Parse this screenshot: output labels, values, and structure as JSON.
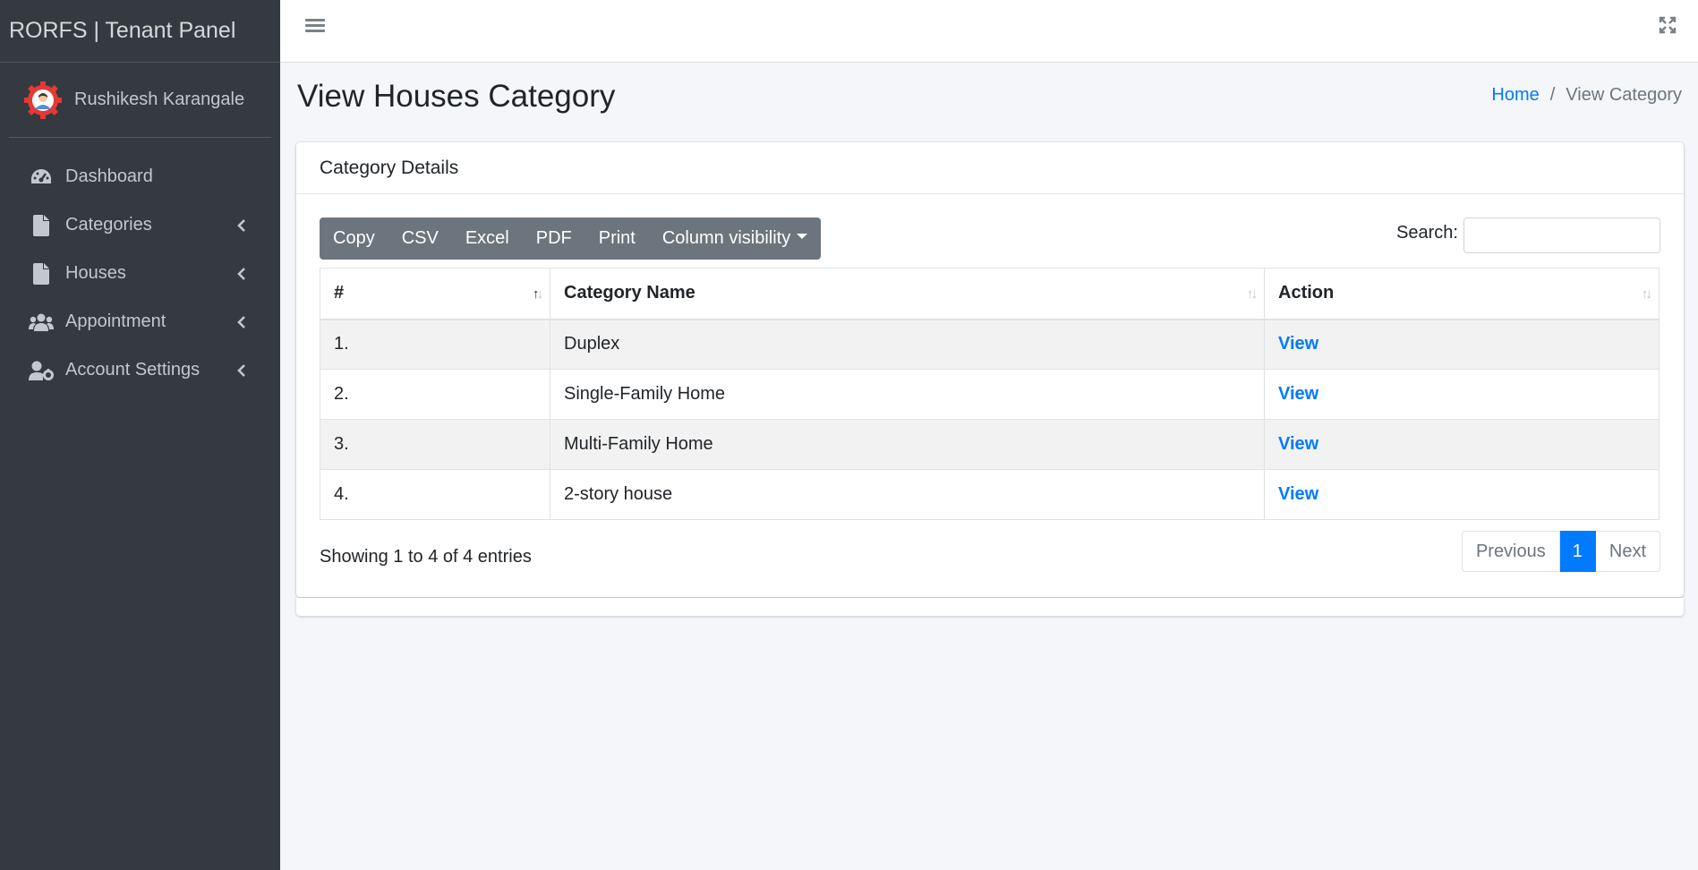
{
  "brand": "RORFS | Tenant Panel",
  "user": {
    "name": "Rushikesh Karangale"
  },
  "sidebar": {
    "items": [
      {
        "label": "Dashboard",
        "icon": "tachometer-icon",
        "has_arrow": false
      },
      {
        "label": "Categories",
        "icon": "file-icon",
        "has_arrow": true
      },
      {
        "label": "Houses",
        "icon": "file-icon",
        "has_arrow": true
      },
      {
        "label": "Appointment",
        "icon": "users-icon",
        "has_arrow": true
      },
      {
        "label": "Account Settings",
        "icon": "user-cog-icon",
        "has_arrow": true
      }
    ]
  },
  "page": {
    "title": "View Houses Category",
    "breadcrumb": {
      "home": "Home",
      "separator": "/",
      "current": "View Category"
    }
  },
  "card": {
    "title": "Category Details",
    "buttons": {
      "copy": "Copy",
      "csv": "CSV",
      "excel": "Excel",
      "pdf": "PDF",
      "print": "Print",
      "colvis": "Column visibility"
    },
    "search": {
      "label": "Search:",
      "value": "",
      "placeholder": ""
    },
    "table": {
      "headers": [
        "#",
        "Category Name",
        "Action"
      ],
      "rows": [
        {
          "num": "1.",
          "name": "Duplex",
          "action": "View"
        },
        {
          "num": "2.",
          "name": "Single-Family Home",
          "action": "View"
        },
        {
          "num": "3.",
          "name": "Multi-Family Home",
          "action": "View"
        },
        {
          "num": "4.",
          "name": "2-story house",
          "action": "View"
        }
      ]
    },
    "info": "Showing 1 to 4 of 4 entries",
    "pagination": {
      "previous": "Previous",
      "current": "1",
      "next": "Next"
    }
  },
  "colors": {
    "sidebar_bg": "#343a40",
    "primary": "#007bff",
    "button_group": "#6c757d"
  }
}
